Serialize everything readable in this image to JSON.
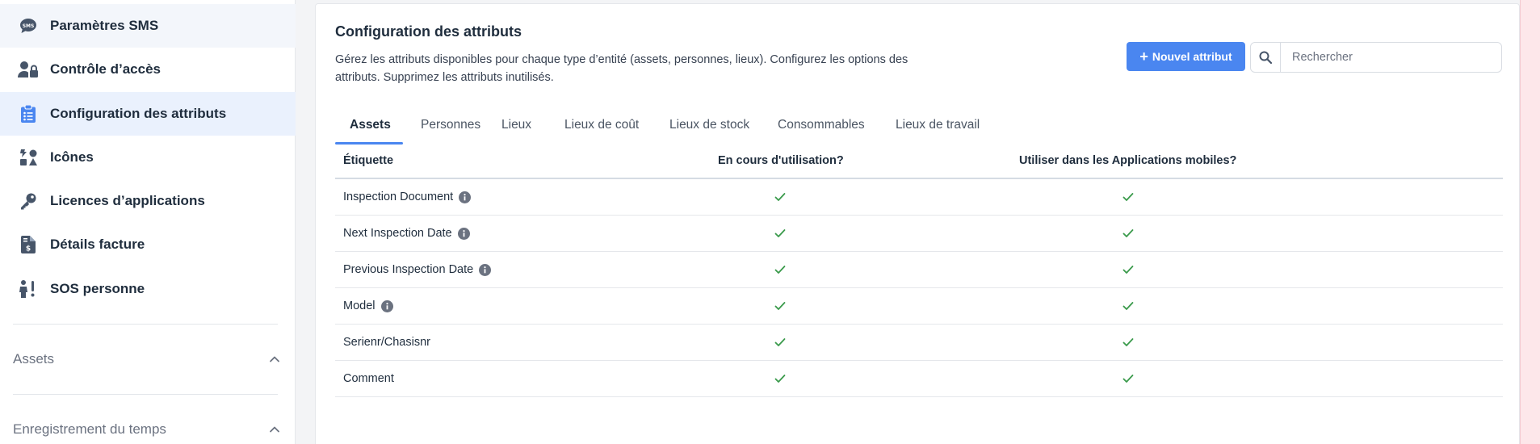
{
  "sidebar": {
    "items": [
      {
        "label": "Paramètres SMS",
        "icon": "sms-bubble-icon"
      },
      {
        "label": "Contrôle d’accès",
        "icon": "user-lock-icon"
      },
      {
        "label": "Configuration des attributs",
        "icon": "clipboard-list-icon",
        "active": true
      },
      {
        "label": "Icônes",
        "icon": "icons-icon"
      },
      {
        "label": "Licences d’applications",
        "icon": "key-icon"
      },
      {
        "label": "Détails facture",
        "icon": "invoice-icon"
      },
      {
        "label": "SOS personne",
        "icon": "person-alert-icon"
      }
    ],
    "sections": [
      {
        "label": "Assets",
        "icon": "chevron-up-icon"
      },
      {
        "label": "Enregistrement du temps",
        "icon": "chevron-up-icon"
      }
    ]
  },
  "main": {
    "title": "Configuration des attributs",
    "description": "Gérez les attributs disponibles pour chaque type d’entité (assets, personnes, lieux). Configurez les options des attributs. Supprimez les attributs inutilisés.",
    "new_button": {
      "icon_text": "+",
      "label": "Nouvel attribut"
    },
    "search": {
      "placeholder": "Rechercher",
      "value": ""
    },
    "tabs": [
      {
        "label": "Assets",
        "active": true
      },
      {
        "label": "Personnes"
      },
      {
        "label": "Lieux"
      },
      {
        "label": "Lieux de coût"
      },
      {
        "label": "Lieux de stock"
      },
      {
        "label": "Consommables"
      },
      {
        "label": "Lieux de travail"
      }
    ],
    "table": {
      "headers": [
        "Étiquette",
        "En cours d'utilisation?",
        "Utiliser dans les Applications mobiles?"
      ],
      "rows": [
        {
          "label": "Inspection Document",
          "info": true,
          "in_use": true,
          "mobile": true
        },
        {
          "label": "Next Inspection Date",
          "info": true,
          "in_use": true,
          "mobile": true
        },
        {
          "label": "Previous Inspection Date",
          "info": true,
          "in_use": true,
          "mobile": true
        },
        {
          "label": "Model",
          "info": true,
          "in_use": true,
          "mobile": true
        },
        {
          "label": "Serienr/Chasisnr",
          "info": false,
          "in_use": true,
          "mobile": true
        },
        {
          "label": "Comment",
          "info": false,
          "in_use": true,
          "mobile": true
        }
      ]
    }
  },
  "colors": {
    "accent": "#4a86f0",
    "check": "#3a9a4b",
    "icon": "#475569",
    "active_bg": "#eaf1fd"
  }
}
